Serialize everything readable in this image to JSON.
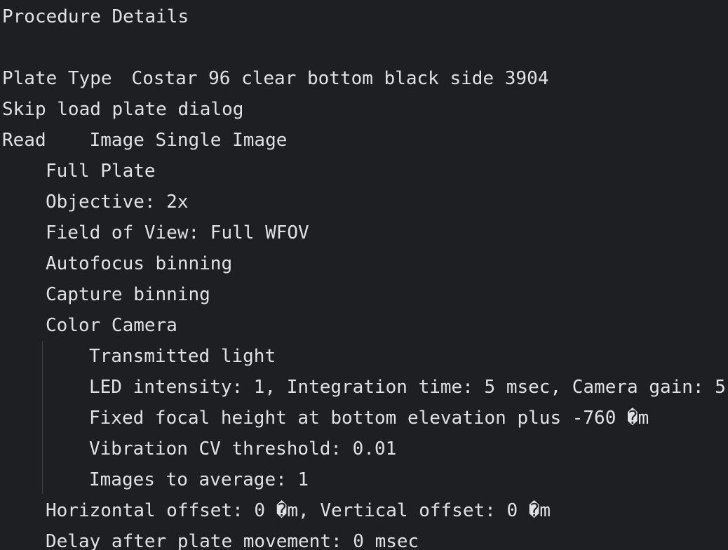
{
  "document": {
    "title": "Procedure Details",
    "plate_type_label": "Plate Type",
    "plate_type_value": "Costar 96 clear bottom black side 3904",
    "skip_dialog": "Skip load plate dialog",
    "read_label": "Read",
    "read_value": "Image Single Image",
    "full_plate": "Full Plate",
    "objective": "Objective: 2x",
    "field_of_view": "Field of View: Full WFOV",
    "autofocus_binning": "Autofocus binning",
    "capture_binning": "Capture binning",
    "color_camera": "Color Camera",
    "channel": {
      "name": "Transmitted light",
      "settings": "LED intensity: 1, Integration time: 5 msec, Camera gain: 5",
      "focal_height": "Fixed focal height at bottom elevation plus -760 �m",
      "vibration": "Vibration CV threshold: 0.01",
      "images_to_average": "Images to average: 1"
    },
    "offsets": "Horizontal offset: 0 �m, Vertical offset: 0 �m",
    "delay": "Delay after plate movement: 0 msec"
  }
}
